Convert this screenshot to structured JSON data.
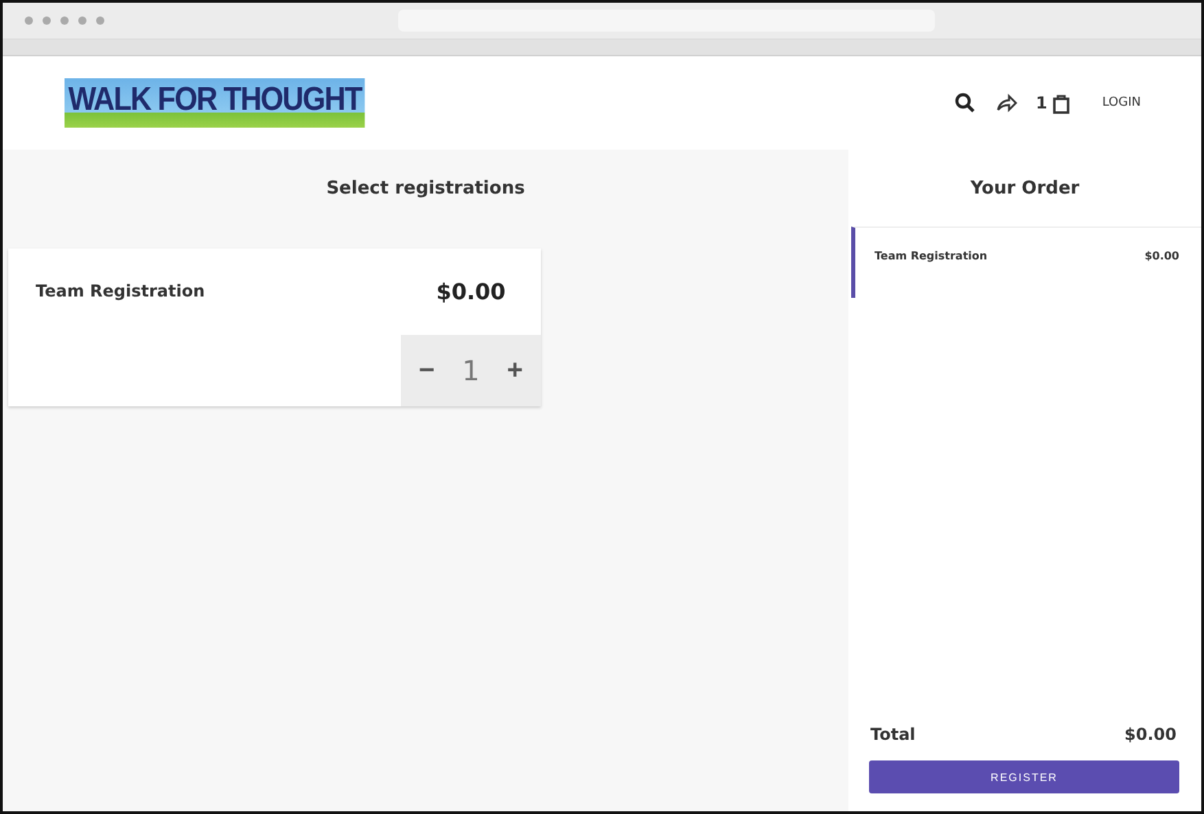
{
  "header": {
    "logo": "WALK FOR THOUGHT",
    "cart_count": "1",
    "login": "LOGIN"
  },
  "registrations": {
    "title": "Select registrations",
    "items": [
      {
        "name": "Team Registration",
        "price": "$0.00",
        "minus": "−",
        "quantity": "1",
        "plus": "+"
      }
    ]
  },
  "order": {
    "title": "Your Order",
    "items": [
      {
        "name": "Team Registration",
        "price": "$0.00",
        "selected": true
      }
    ],
    "total_label": "Total",
    "total": "$0.00",
    "button": "REGISTER"
  }
}
